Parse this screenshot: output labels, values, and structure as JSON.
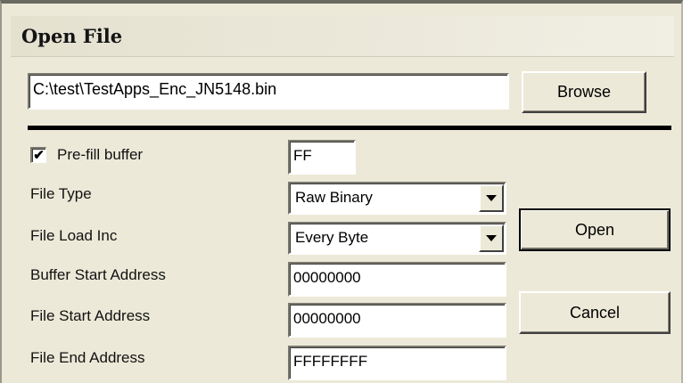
{
  "window": {
    "title": "Open File"
  },
  "file_path": {
    "value": "C:\\test\\TestApps_Enc_JN5148.bin"
  },
  "buttons": {
    "browse": "Browse",
    "open": "Open",
    "cancel": "Cancel"
  },
  "options": {
    "prefill": {
      "label": "Pre-fill buffer",
      "checked": true,
      "check_glyph": "✔",
      "value": "FF"
    },
    "file_type": {
      "label": "File Type",
      "value": "Raw Binary"
    },
    "file_load_inc": {
      "label": "File Load Inc",
      "value": "Every Byte"
    },
    "buffer_start": {
      "label": "Buffer Start Address",
      "value": "00000000"
    },
    "file_start": {
      "label": "File Start Address",
      "value": "00000000"
    },
    "file_end": {
      "label": "File End Address",
      "value": "FFFFFFFF"
    }
  },
  "colors": {
    "dialog_background": "#ece9d8",
    "separator": "#000000"
  }
}
